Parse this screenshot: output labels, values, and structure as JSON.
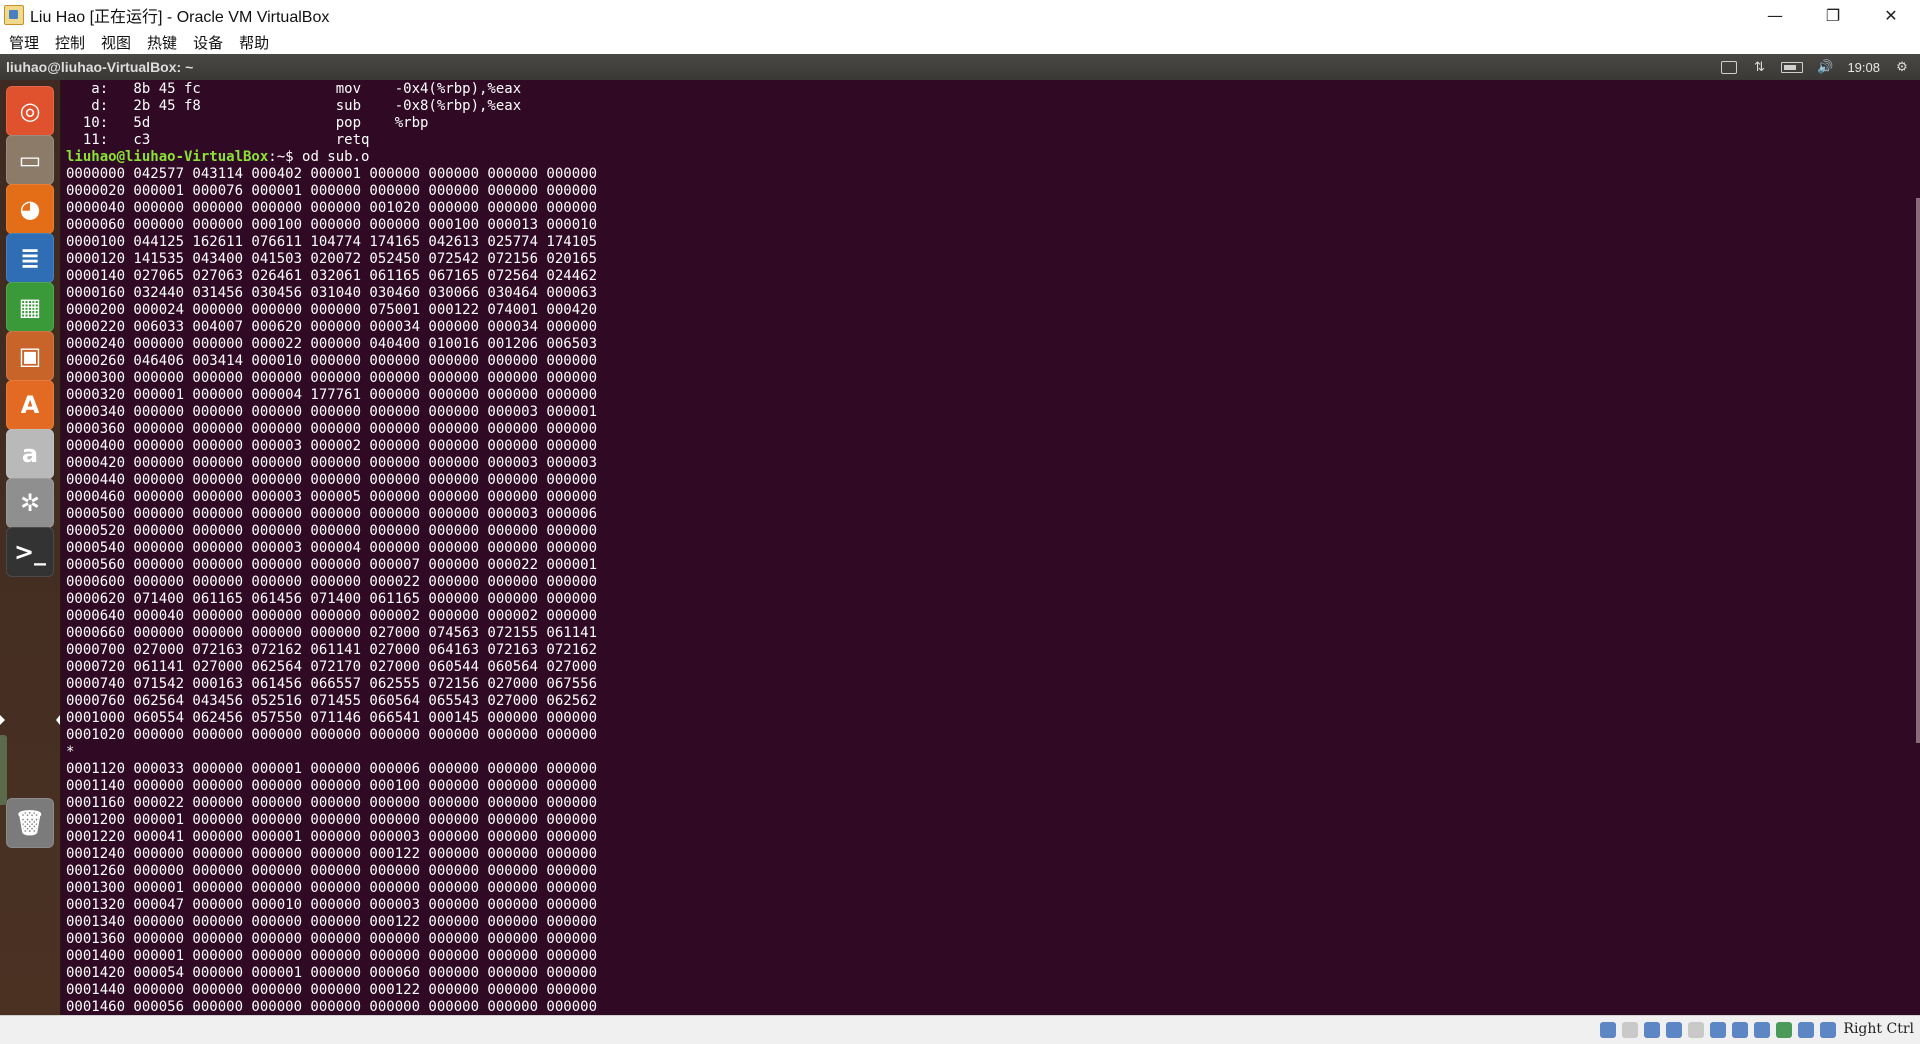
{
  "window": {
    "title": "Liu Hao [正在运行] - Oracle VM VirtualBox",
    "controls": {
      "minimize": "—",
      "maximize": "❐",
      "close": "✕"
    }
  },
  "menubar": [
    "管理",
    "控制",
    "视图",
    "热键",
    "设备",
    "帮助"
  ],
  "panel": {
    "title": "liuhao@liuhao-VirtualBox: ~",
    "network_icon": "⇅",
    "volume_icon": "🔊",
    "clock": "19:08",
    "settings_icon": "⚙"
  },
  "launcher": [
    {
      "name": "ubuntu-dash-icon",
      "glyph": "◎",
      "color": "#e0522e"
    },
    {
      "name": "files-icon",
      "glyph": "▭",
      "color": "#8d7b6a"
    },
    {
      "name": "firefox-icon",
      "glyph": "◕",
      "color": "#e46d17"
    },
    {
      "name": "libreoffice-writer-icon",
      "glyph": "≣",
      "color": "#2f6eb5"
    },
    {
      "name": "libreoffice-calc-icon",
      "glyph": "▦",
      "color": "#3a9a3a"
    },
    {
      "name": "libreoffice-impress-icon",
      "glyph": "▣",
      "color": "#c8642a"
    },
    {
      "name": "software-center-icon",
      "glyph": "A",
      "color": "#e26a22"
    },
    {
      "name": "amazon-icon",
      "glyph": "a",
      "color": "#b9b9b9"
    },
    {
      "name": "system-settings-icon",
      "glyph": "✲",
      "color": "#8f8f8f"
    },
    {
      "name": "terminal-icon",
      "glyph": ">_",
      "color": "#333333"
    },
    {
      "name": "trash-icon",
      "glyph": "🗑",
      "color": "#7b7b7b"
    }
  ],
  "terminal": {
    "lines": [
      "   a:   8b 45 fc                mov    -0x4(%rbp),%eax",
      "   d:   2b 45 f8                sub    -0x8(%rbp),%eax",
      "  10:   5d                      pop    %rbp",
      "  11:   c3                      retq",
      "",
      "0000000 042577 043114 000402 000001 000000 000000 000000 000000",
      "0000020 000001 000076 000001 000000 000000 000000 000000 000000",
      "0000040 000000 000000 000000 000000 001020 000000 000000 000000",
      "0000060 000000 000000 000100 000000 000000 000100 000013 000010",
      "0000100 044125 162611 076611 104774 174165 042613 025774 174105",
      "0000120 141535 043400 041503 020072 052450 072542 072156 020165",
      "0000140 027065 027063 026461 032061 061165 067165 072564 024462",
      "0000160 032440 031456 030456 031040 030460 030066 030464 000063",
      "0000200 000024 000000 000000 000000 075001 000122 074001 000420",
      "0000220 006033 004007 000620 000000 000034 000000 000034 000000",
      "0000240 000000 000000 000022 000000 040400 010016 001206 006503",
      "0000260 046406 003414 000010 000000 000000 000000 000000 000000",
      "0000300 000000 000000 000000 000000 000000 000000 000000 000000",
      "0000320 000001 000000 000004 177761 000000 000000 000000 000000",
      "0000340 000000 000000 000000 000000 000000 000000 000003 000001",
      "0000360 000000 000000 000000 000000 000000 000000 000000 000000",
      "0000400 000000 000000 000003 000002 000000 000000 000000 000000",
      "0000420 000000 000000 000000 000000 000000 000000 000003 000003",
      "0000440 000000 000000 000000 000000 000000 000000 000000 000000",
      "0000460 000000 000000 000003 000005 000000 000000 000000 000000",
      "0000500 000000 000000 000000 000000 000000 000000 000003 000006",
      "0000520 000000 000000 000000 000000 000000 000000 000000 000000",
      "0000540 000000 000000 000003 000004 000000 000000 000000 000000",
      "0000560 000000 000000 000000 000000 000007 000000 000022 000001",
      "0000600 000000 000000 000000 000000 000022 000000 000000 000000",
      "0000620 071400 061165 061456 071400 061165 000000 000000 000000",
      "0000640 000040 000000 000000 000000 000002 000000 000002 000000",
      "0000660 000000 000000 000000 000000 027000 074563 072155 061141",
      "0000700 027000 072163 072162 061141 027000 064163 072163 072162",
      "0000720 061141 027000 062564 072170 027000 060544 060564 027000",
      "0000740 071542 000163 061456 066557 062555 072156 027000 067556",
      "0000760 062564 043456 052516 071455 060564 065543 027000 062562",
      "0001000 060554 062456 057550 071146 066541 000145 000000 000000",
      "0001020 000000 000000 000000 000000 000000 000000 000000 000000",
      "*",
      "0001120 000033 000000 000001 000000 000006 000000 000000 000000",
      "0001140 000000 000000 000000 000000 000100 000000 000000 000000",
      "0001160 000022 000000 000000 000000 000000 000000 000000 000000",
      "0001200 000001 000000 000000 000000 000000 000000 000000 000000",
      "0001220 000041 000000 000001 000000 000003 000000 000000 000000",
      "0001240 000000 000000 000000 000000 000122 000000 000000 000000",
      "0001260 000000 000000 000000 000000 000000 000000 000000 000000",
      "0001300 000001 000000 000000 000000 000000 000000 000000 000000",
      "0001320 000047 000000 000010 000000 000003 000000 000000 000000",
      "0001340 000000 000000 000000 000000 000122 000000 000000 000000",
      "0001360 000000 000000 000000 000000 000000 000000 000000 000000",
      "0001400 000001 000000 000000 000000 000000 000000 000000 000000",
      "0001420 000054 000000 000001 000000 000060 000000 000000 000000",
      "0001440 000000 000000 000000 000000 000122 000000 000000 000000",
      "0001460 000056 000000 000000 000000 000000 000000 000000 000000"
    ],
    "prompt": {
      "user_host": "liuhao@liuhao-VirtualBox",
      "path": ":~$",
      "command": " od sub.o",
      "line_index": 4
    }
  },
  "statusbar": {
    "host_key": "Right Ctrl"
  }
}
